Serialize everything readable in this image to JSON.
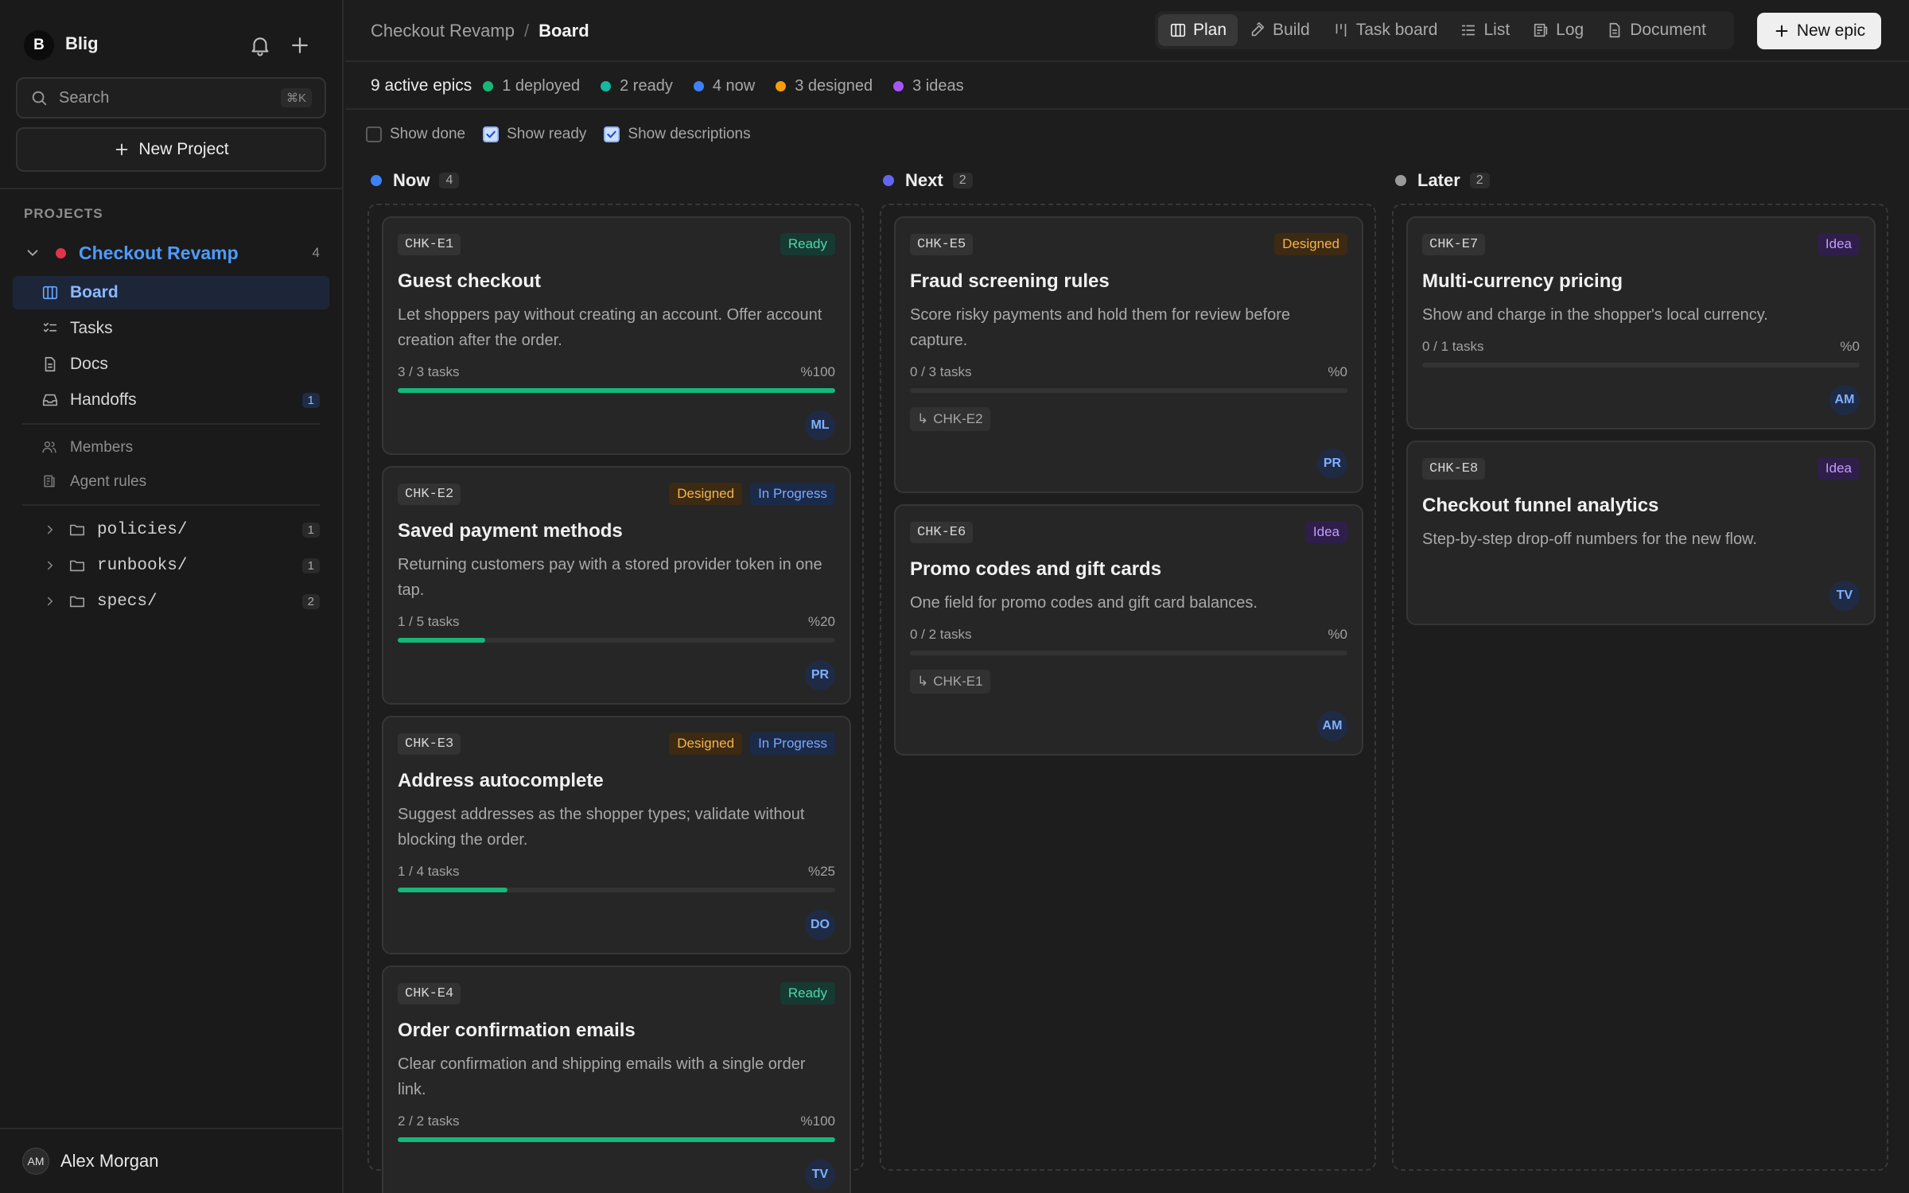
{
  "workspace": {
    "initial": "B",
    "name": "Blig"
  },
  "sidebar": {
    "search_placeholder": "Search",
    "search_shortcut": "⌘K",
    "new_project_label": "New Project",
    "projects_heading": "PROJECTS",
    "project": {
      "name": "Checkout Revamp",
      "count": "4",
      "color": "#e0344a"
    },
    "nav": [
      {
        "label": "Board",
        "icon": "board-icon",
        "active": true
      },
      {
        "label": "Tasks",
        "icon": "tasks-icon"
      },
      {
        "label": "Docs",
        "icon": "docs-icon"
      },
      {
        "label": "Handoffs",
        "icon": "inbox-icon",
        "badge": "1"
      }
    ],
    "secondary": [
      {
        "label": "Members",
        "icon": "members-icon"
      },
      {
        "label": "Agent rules",
        "icon": "rules-icon"
      }
    ],
    "folders": [
      {
        "label": "policies/",
        "count": "1"
      },
      {
        "label": "runbooks/",
        "count": "1"
      },
      {
        "label": "specs/",
        "count": "2"
      }
    ],
    "user": {
      "initials": "AM",
      "name": "Alex Morgan"
    }
  },
  "header": {
    "breadcrumb_project": "Checkout Revamp",
    "breadcrumb_sep": "/",
    "breadcrumb_page": "Board",
    "views": [
      {
        "label": "Plan",
        "icon": "plan-icon",
        "active": true
      },
      {
        "label": "Build",
        "icon": "build-icon"
      },
      {
        "label": "Task board",
        "icon": "taskboard-icon"
      },
      {
        "label": "List",
        "icon": "list-icon"
      },
      {
        "label": "Log",
        "icon": "log-icon"
      },
      {
        "label": "Document",
        "icon": "document-icon"
      }
    ],
    "new_epic_label": "New epic"
  },
  "stats": {
    "active": "9 active epics",
    "items": [
      {
        "label": "1 deployed",
        "color": "#14b87a"
      },
      {
        "label": "2 ready",
        "color": "#14b8a0"
      },
      {
        "label": "4 now",
        "color": "#3b82f6"
      },
      {
        "label": "3 designed",
        "color": "#f59e0b"
      },
      {
        "label": "3 ideas",
        "color": "#a855f7"
      }
    ]
  },
  "filters": [
    {
      "label": "Show done",
      "checked": false
    },
    {
      "label": "Show ready",
      "checked": true
    },
    {
      "label": "Show descriptions",
      "checked": true
    }
  ],
  "columns": [
    {
      "title": "Now",
      "count": "4",
      "color": "#3b82f6",
      "cards": [
        {
          "id": "CHK-E1",
          "badges": [
            {
              "label": "Ready",
              "kind": "ready"
            }
          ],
          "title": "Guest checkout",
          "desc": "Let shoppers pay without creating an account. Offer account creation after the order.",
          "tasks": "3 / 3 tasks",
          "pct_label": "%100",
          "progress": 1.0,
          "assignee": "ML"
        },
        {
          "id": "CHK-E2",
          "badges": [
            {
              "label": "Designed",
              "kind": "designed"
            },
            {
              "label": "In Progress",
              "kind": "progress"
            }
          ],
          "title": "Saved payment methods",
          "desc": "Returning customers pay with a stored provider token in one tap.",
          "tasks": "1 / 5 tasks",
          "pct_label": "%20",
          "progress": 0.2,
          "assignee": "PR"
        },
        {
          "id": "CHK-E3",
          "badges": [
            {
              "label": "Designed",
              "kind": "designed"
            },
            {
              "label": "In Progress",
              "kind": "progress"
            }
          ],
          "title": "Address autocomplete",
          "desc": "Suggest addresses as the shopper types; validate without blocking the order.",
          "tasks": "1 / 4 tasks",
          "pct_label": "%25",
          "progress": 0.25,
          "assignee": "DO"
        },
        {
          "id": "CHK-E4",
          "badges": [
            {
              "label": "Ready",
              "kind": "ready"
            }
          ],
          "title": "Order confirmation emails",
          "desc": "Clear confirmation and shipping emails with a single order link.",
          "tasks": "2 / 2 tasks",
          "pct_label": "%100",
          "progress": 1.0,
          "assignee": "TV"
        }
      ]
    },
    {
      "title": "Next",
      "count": "2",
      "color": "#6366f1",
      "cards": [
        {
          "id": "CHK-E5",
          "badges": [
            {
              "label": "Designed",
              "kind": "designed"
            }
          ],
          "title": "Fraud screening rules",
          "desc": "Score risky payments and hold them for review before capture.",
          "tasks": "0 / 3 tasks",
          "pct_label": "%0",
          "progress": 0,
          "dependency": "CHK-E2",
          "assignee": "PR"
        },
        {
          "id": "CHK-E6",
          "badges": [
            {
              "label": "Idea",
              "kind": "idea"
            }
          ],
          "title": "Promo codes and gift cards",
          "desc": "One field for promo codes and gift card balances.",
          "tasks": "0 / 2 tasks",
          "pct_label": "%0",
          "progress": 0,
          "dependency": "CHK-E1",
          "assignee": "AM"
        }
      ]
    },
    {
      "title": "Later",
      "count": "2",
      "color": "#9a9a9a",
      "cards": [
        {
          "id": "CHK-E7",
          "badges": [
            {
              "label": "Idea",
              "kind": "idea"
            }
          ],
          "title": "Multi-currency pricing",
          "desc": "Show and charge in the shopper's local currency.",
          "tasks": "0 / 1 tasks",
          "pct_label": "%0",
          "progress": 0,
          "assignee": "AM"
        },
        {
          "id": "CHK-E8",
          "badges": [
            {
              "label": "Idea",
              "kind": "idea"
            }
          ],
          "title": "Checkout funnel analytics",
          "desc": "Step-by-step drop-off numbers for the new flow.",
          "assignee": "TV"
        }
      ]
    }
  ]
}
